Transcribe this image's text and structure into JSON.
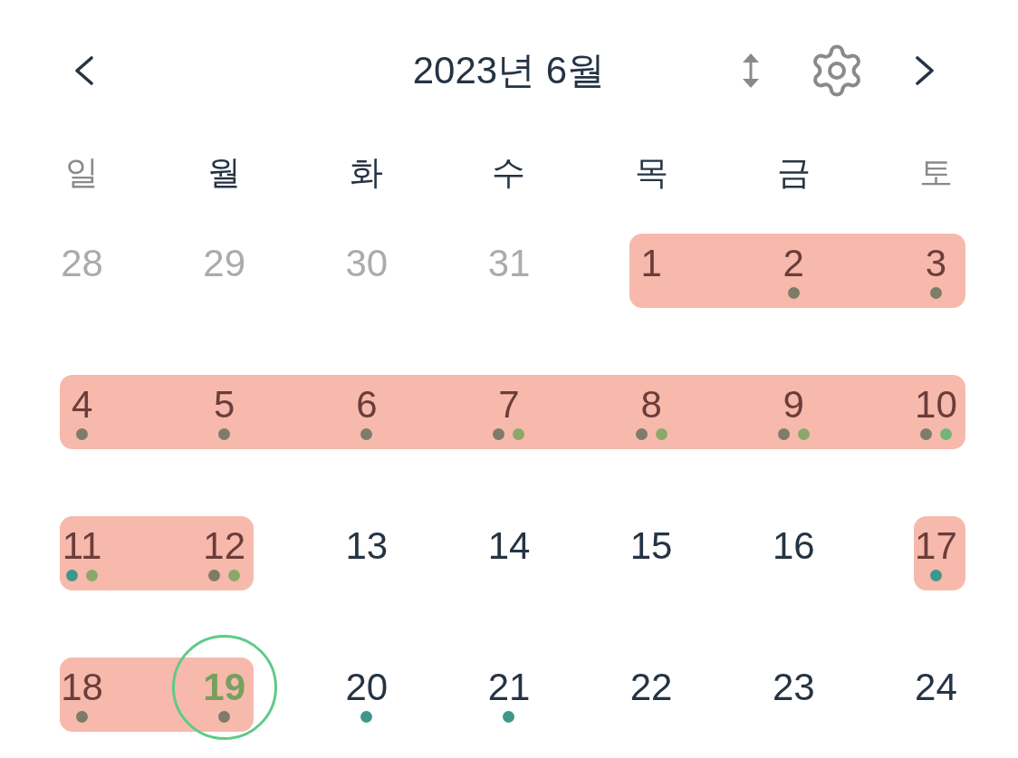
{
  "header": {
    "title": "2023년 6월"
  },
  "weekdays": [
    {
      "label": "일",
      "weekend": true
    },
    {
      "label": "월",
      "weekend": false
    },
    {
      "label": "화",
      "weekend": false
    },
    {
      "label": "수",
      "weekend": false
    },
    {
      "label": "목",
      "weekend": false
    },
    {
      "label": "금",
      "weekend": false
    },
    {
      "label": "토",
      "weekend": true
    }
  ],
  "weeks": [
    {
      "days": [
        {
          "label": "28",
          "kind": "other_month",
          "highlighted": false
        },
        {
          "label": "29",
          "kind": "other_month",
          "highlighted": false
        },
        {
          "label": "30",
          "kind": "other_month",
          "highlighted": false
        },
        {
          "label": "31",
          "kind": "other_month",
          "highlighted": false
        },
        {
          "label": "1",
          "kind": "day",
          "highlighted": true
        },
        {
          "label": "2",
          "kind": "day",
          "highlighted": true,
          "dots": [
            {
              "color": "#7e7b69"
            }
          ]
        },
        {
          "label": "3",
          "kind": "day",
          "highlighted": true,
          "dots": [
            {
              "color": "#7e7b69"
            }
          ]
        }
      ]
    },
    {
      "days": [
        {
          "label": "4",
          "kind": "day",
          "highlighted": true,
          "dots": [
            {
              "color": "#7e7b69"
            }
          ]
        },
        {
          "label": "5",
          "kind": "day",
          "highlighted": true,
          "dots": [
            {
              "color": "#7e7b69"
            }
          ]
        },
        {
          "label": "6",
          "kind": "day",
          "highlighted": true,
          "dots": [
            {
              "color": "#7e7b69"
            }
          ]
        },
        {
          "label": "7",
          "kind": "day",
          "highlighted": true,
          "dots": [
            {
              "color": "#7e7b69"
            },
            {
              "color": "#8ba86a"
            }
          ]
        },
        {
          "label": "8",
          "kind": "day",
          "highlighted": true,
          "dots": [
            {
              "color": "#7e7b69"
            },
            {
              "color": "#8ba86a"
            }
          ]
        },
        {
          "label": "9",
          "kind": "day",
          "highlighted": true,
          "dots": [
            {
              "color": "#7e7b69"
            },
            {
              "color": "#8ba86a"
            }
          ]
        },
        {
          "label": "10",
          "kind": "day",
          "highlighted": true,
          "dots": [
            {
              "color": "#7e7b69"
            },
            {
              "color": "#74b47a"
            }
          ]
        }
      ]
    },
    {
      "days": [
        {
          "label": "11",
          "kind": "day",
          "highlighted": true,
          "dots": [
            {
              "color": "#3f978a"
            },
            {
              "color": "#8ba86a"
            }
          ]
        },
        {
          "label": "12",
          "kind": "day",
          "highlighted": true,
          "dots": [
            {
              "color": "#7e7b69"
            },
            {
              "color": "#8ba86a"
            }
          ]
        },
        {
          "label": "13",
          "kind": "day",
          "highlighted": false
        },
        {
          "label": "14",
          "kind": "day",
          "highlighted": false
        },
        {
          "label": "15",
          "kind": "day",
          "highlighted": false
        },
        {
          "label": "16",
          "kind": "day",
          "highlighted": false
        },
        {
          "label": "17",
          "kind": "day",
          "highlighted": true,
          "dots": [
            {
              "color": "#3f978a"
            }
          ]
        }
      ]
    },
    {
      "days": [
        {
          "label": "18",
          "kind": "day",
          "highlighted": true,
          "dots": [
            {
              "color": "#7e7b69"
            }
          ]
        },
        {
          "label": "19",
          "kind": "today",
          "highlighted": true,
          "dots": [
            {
              "color": "#7e7b69"
            }
          ]
        },
        {
          "label": "20",
          "kind": "day",
          "highlighted": false,
          "dots": [
            {
              "color": "#3f978a"
            }
          ]
        },
        {
          "label": "21",
          "kind": "day",
          "highlighted": false,
          "dots": [
            {
              "color": "#3f978a"
            }
          ]
        },
        {
          "label": "22",
          "kind": "day",
          "highlighted": false
        },
        {
          "label": "23",
          "kind": "day",
          "highlighted": false
        },
        {
          "label": "24",
          "kind": "day",
          "highlighted": false
        }
      ]
    }
  ]
}
